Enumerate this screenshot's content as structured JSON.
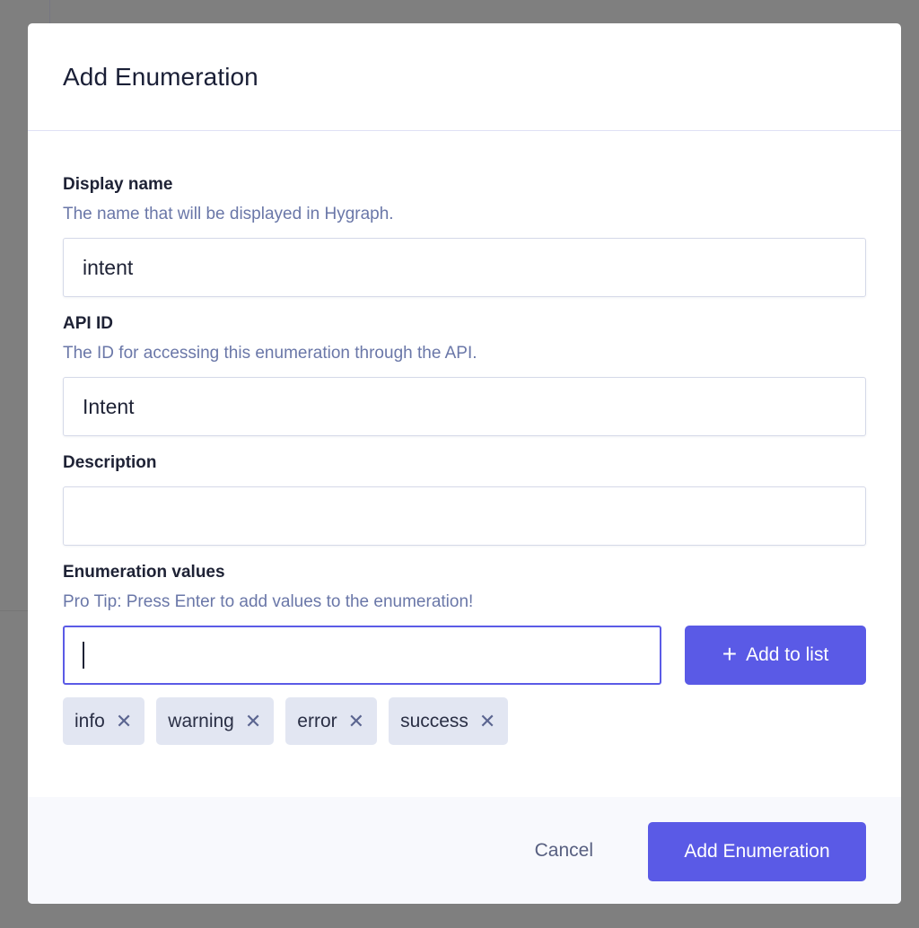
{
  "modal": {
    "title": "Add Enumeration"
  },
  "fields": {
    "display_name": {
      "label": "Display name",
      "help": "The name that will be displayed in Hygraph.",
      "value": "intent"
    },
    "api_id": {
      "label": "API ID",
      "help": "The ID for accessing this enumeration through the API.",
      "value": "Intent"
    },
    "description": {
      "label": "Description",
      "value": ""
    },
    "enum_values": {
      "label": "Enumeration values",
      "help": "Pro Tip: Press Enter to add values to the enumeration!",
      "input_value": "",
      "add_button_label": "Add to list",
      "add_button_icon": "plus-icon",
      "remove_icon": "close-icon",
      "tags": [
        {
          "label": "info"
        },
        {
          "label": "warning"
        },
        {
          "label": "error"
        },
        {
          "label": "success"
        }
      ]
    }
  },
  "footer": {
    "cancel_label": "Cancel",
    "submit_label": "Add Enumeration"
  },
  "colors": {
    "accent": "#5a5ae6",
    "help_text": "#6a77a8",
    "tag_bg": "#e2e6f2",
    "overlay": "#7f7f7f"
  }
}
